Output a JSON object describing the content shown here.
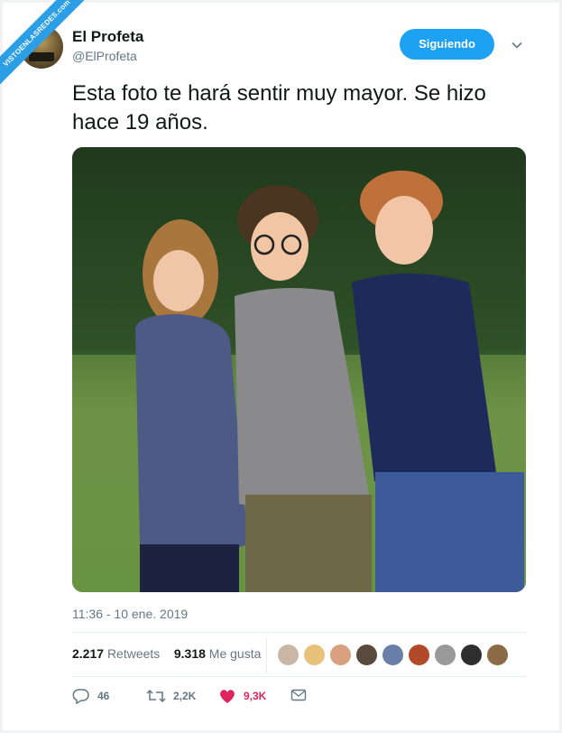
{
  "watermark": {
    "text": "VISTOENLASREDES.com"
  },
  "profile": {
    "name": "El Profeta",
    "handle": "@ElProfeta",
    "avatar_icon": "avatar-image"
  },
  "follow_button": {
    "label": "Siguiendo",
    "color": "#1da1f2"
  },
  "tweet": {
    "text": "Esta foto te hará sentir muy mayor. Se hizo hace 19 años.",
    "photo_icon": "photo-image",
    "timestamp": "11:36 - 10 ene. 2019"
  },
  "stats": {
    "retweets_count": "2.217",
    "retweets_label": "Retweets",
    "likes_count": "9.318",
    "likes_label": "Me gusta"
  },
  "likers": [
    {
      "icon": "avatar-1",
      "color": "#c9b6a6"
    },
    {
      "icon": "avatar-2",
      "color": "#e8c27a"
    },
    {
      "icon": "avatar-3",
      "color": "#d8a07f"
    },
    {
      "icon": "avatar-4",
      "color": "#5a4a3e"
    },
    {
      "icon": "avatar-5",
      "color": "#6a7fa8"
    },
    {
      "icon": "avatar-6",
      "color": "#b24a2a"
    },
    {
      "icon": "avatar-7",
      "color": "#9a9a9a"
    },
    {
      "icon": "avatar-8",
      "color": "#2e2e2e"
    },
    {
      "icon": "avatar-9",
      "color": "#8b6a46"
    }
  ],
  "actions": {
    "reply_count": "46",
    "retweet_count": "2,2K",
    "like_count": "9,3K",
    "like_color": "#e0245e"
  }
}
